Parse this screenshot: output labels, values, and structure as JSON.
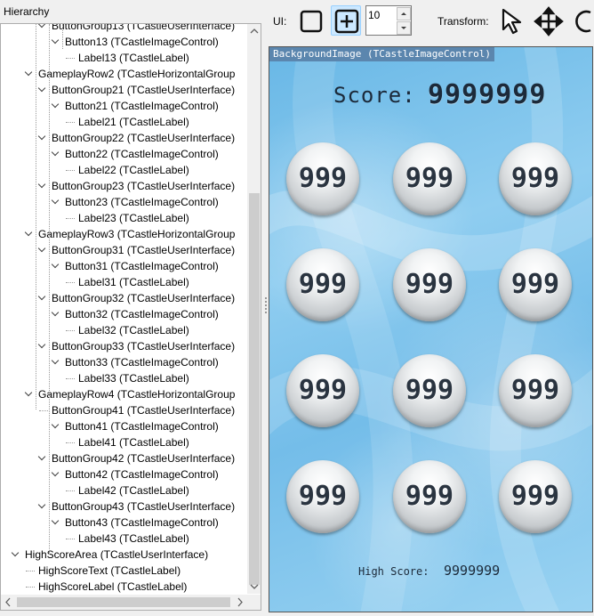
{
  "panel": {
    "title": "Hierarchy"
  },
  "tree": [
    {
      "label": "ButtonGroup13 (TCastleUserInterface)",
      "depth": 3,
      "expandable": true
    },
    {
      "label": "Button13 (TCastleImageControl)",
      "depth": 4,
      "expandable": true
    },
    {
      "label": "Label13 (TCastleLabel)",
      "depth": 5,
      "expandable": false
    },
    {
      "label": "GameplayRow2 (TCastleHorizontalGroup",
      "depth": 2,
      "expandable": true
    },
    {
      "label": "ButtonGroup21 (TCastleUserInterface)",
      "depth": 3,
      "expandable": true
    },
    {
      "label": "Button21 (TCastleImageControl)",
      "depth": 4,
      "expandable": true
    },
    {
      "label": "Label21 (TCastleLabel)",
      "depth": 5,
      "expandable": false
    },
    {
      "label": "ButtonGroup22 (TCastleUserInterface)",
      "depth": 3,
      "expandable": true
    },
    {
      "label": "Button22 (TCastleImageControl)",
      "depth": 4,
      "expandable": true
    },
    {
      "label": "Label22 (TCastleLabel)",
      "depth": 5,
      "expandable": false
    },
    {
      "label": "ButtonGroup23 (TCastleUserInterface)",
      "depth": 3,
      "expandable": true
    },
    {
      "label": "Button23 (TCastleImageControl)",
      "depth": 4,
      "expandable": true
    },
    {
      "label": "Label23 (TCastleLabel)",
      "depth": 5,
      "expandable": false
    },
    {
      "label": "GameplayRow3 (TCastleHorizontalGroup",
      "depth": 2,
      "expandable": true
    },
    {
      "label": "ButtonGroup31 (TCastleUserInterface)",
      "depth": 3,
      "expandable": true
    },
    {
      "label": "Button31 (TCastleImageControl)",
      "depth": 4,
      "expandable": true
    },
    {
      "label": "Label31 (TCastleLabel)",
      "depth": 5,
      "expandable": false
    },
    {
      "label": "ButtonGroup32 (TCastleUserInterface)",
      "depth": 3,
      "expandable": true
    },
    {
      "label": "Button32 (TCastleImageControl)",
      "depth": 4,
      "expandable": true
    },
    {
      "label": "Label32 (TCastleLabel)",
      "depth": 5,
      "expandable": false
    },
    {
      "label": "ButtonGroup33 (TCastleUserInterface)",
      "depth": 3,
      "expandable": true
    },
    {
      "label": "Button33 (TCastleImageControl)",
      "depth": 4,
      "expandable": true
    },
    {
      "label": "Label33 (TCastleLabel)",
      "depth": 5,
      "expandable": false
    },
    {
      "label": "GameplayRow4 (TCastleHorizontalGroup",
      "depth": 2,
      "expandable": true
    },
    {
      "label": "ButtonGroup41 (TCastleUserInterface)",
      "depth": 3,
      "expandable": false
    },
    {
      "label": "Button41 (TCastleImageControl)",
      "depth": 4,
      "expandable": true
    },
    {
      "label": "Label41 (TCastleLabel)",
      "depth": 5,
      "expandable": false
    },
    {
      "label": "ButtonGroup42 (TCastleUserInterface)",
      "depth": 3,
      "expandable": true
    },
    {
      "label": "Button42 (TCastleImageControl)",
      "depth": 4,
      "expandable": true
    },
    {
      "label": "Label42 (TCastleLabel)",
      "depth": 5,
      "expandable": false
    },
    {
      "label": "ButtonGroup43 (TCastleUserInterface)",
      "depth": 3,
      "expandable": true
    },
    {
      "label": "Button43 (TCastleImageControl)",
      "depth": 4,
      "expandable": true
    },
    {
      "label": "Label43 (TCastleLabel)",
      "depth": 5,
      "expandable": false
    },
    {
      "label": "HighScoreArea (TCastleUserInterface)",
      "depth": 1,
      "expandable": true
    },
    {
      "label": "HighScoreText (TCastleLabel)",
      "depth": 2,
      "expandable": false
    },
    {
      "label": "HighScoreLabel (TCastleLabel)",
      "depth": 2,
      "expandable": false
    }
  ],
  "toolbar": {
    "ui_label": "UI:",
    "grid_size": "10",
    "transform_label": "Transform:",
    "icons": [
      "select-rect-icon",
      "add-rect-icon",
      "arrow-cursor-icon",
      "move-arrows-icon",
      "rotate-icon"
    ]
  },
  "preview": {
    "caption": "BackgroundImage (TCastleImageControl)",
    "score_label": "Score:",
    "score_value": "9999999",
    "buttons": [
      "999",
      "999",
      "999",
      "999",
      "999",
      "999",
      "999",
      "999",
      "999",
      "999",
      "999",
      "999"
    ],
    "highscore_label": "High Score:",
    "highscore_value": "9999999"
  },
  "colors": {
    "selected_tool_bg": "#cce8ff",
    "caption_bg": "#5b86ae",
    "preview_bg": "#7fc4ec",
    "digit_color": "#1c2a3a"
  }
}
